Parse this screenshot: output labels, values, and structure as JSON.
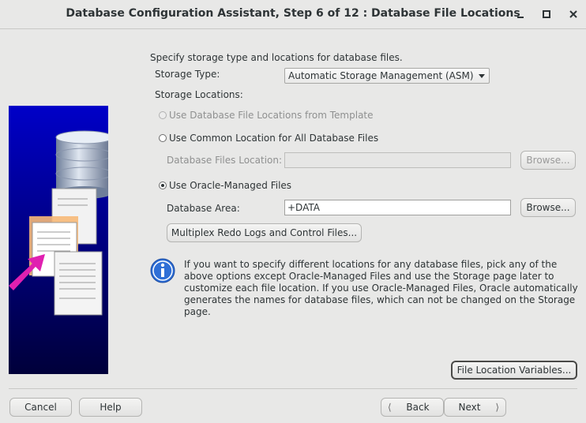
{
  "window": {
    "title": "Database Configuration Assistant, Step 6 of 12 : Database File Locations",
    "minimize_icon": "minimize-icon",
    "maximize_icon": "maximize-icon",
    "close_icon": "close-icon"
  },
  "main": {
    "intro": "Specify storage type and locations for database files.",
    "storage_type_label": "Storage Type:",
    "storage_type_value": "Automatic Storage Management (ASM)",
    "storage_locations_label": "Storage Locations:",
    "options": [
      {
        "label": "Use Database File Locations from Template",
        "selected": false,
        "enabled": false
      },
      {
        "label": "Use Common Location for All Database Files",
        "selected": false,
        "enabled": true
      },
      {
        "label": "Use Oracle-Managed Files",
        "selected": true,
        "enabled": true
      }
    ],
    "db_files_location_label": "Database Files Location:",
    "db_files_location_value": "",
    "browse_label": "Browse...",
    "database_area_label": "Database Area:",
    "database_area_value": "+DATA",
    "multiplex_button": "Multiplex Redo Logs and Control Files...",
    "info_text": "If you want to specify different locations for any database files, pick any of the above options except Oracle-Managed Files and use the Storage page later to customize each file location. If you use Oracle-Managed Files, Oracle automatically generates the names for database files, which can not be changed on the Storage page.",
    "file_location_variables": "File Location Variables..."
  },
  "footer": {
    "cancel": "Cancel",
    "help": "Help",
    "back": "Back",
    "next": "Next"
  },
  "colors": {
    "panel_bg": "#e8e8e7",
    "info_blue": "#2f6fd6",
    "side_dark_blue": "#000080"
  }
}
